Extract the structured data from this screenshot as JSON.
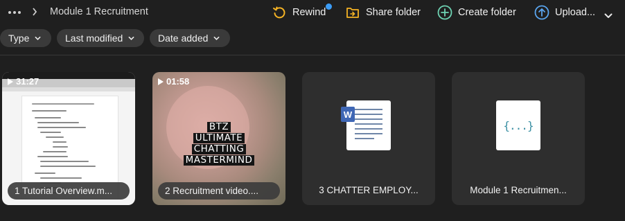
{
  "breadcrumb": {
    "current": "Module 1 Recruitment"
  },
  "toolbar": {
    "rewind_label": "Rewind",
    "share_label": "Share folder",
    "create_label": "Create folder",
    "upload_label": "Upload..."
  },
  "filters": [
    {
      "label": "Type"
    },
    {
      "label": "Last modified"
    },
    {
      "label": "Date added"
    }
  ],
  "items": [
    {
      "name": "1 Tutorial Overview.m...",
      "duration": "31:27",
      "kind": "video"
    },
    {
      "name": "2 Recruitment video....",
      "duration": "01:58",
      "kind": "video",
      "thumbnail_text": [
        "BTZ",
        "ULTIMATE",
        "CHATTING",
        "MASTERMIND"
      ]
    },
    {
      "name": "3 CHATTER EMPLOY...",
      "kind": "word-document",
      "badge": "W"
    },
    {
      "name": "Module 1 Recruitmen...",
      "kind": "json-file",
      "glyph": "{...}"
    }
  ],
  "colors": {
    "background": "#1f1f1f",
    "rewind_accent": "#f5b324",
    "share_accent": "#f5b324",
    "create_accent": "#6ed3b3",
    "upload_accent": "#5aa6f0",
    "notification_dot": "#3b9cf6"
  }
}
